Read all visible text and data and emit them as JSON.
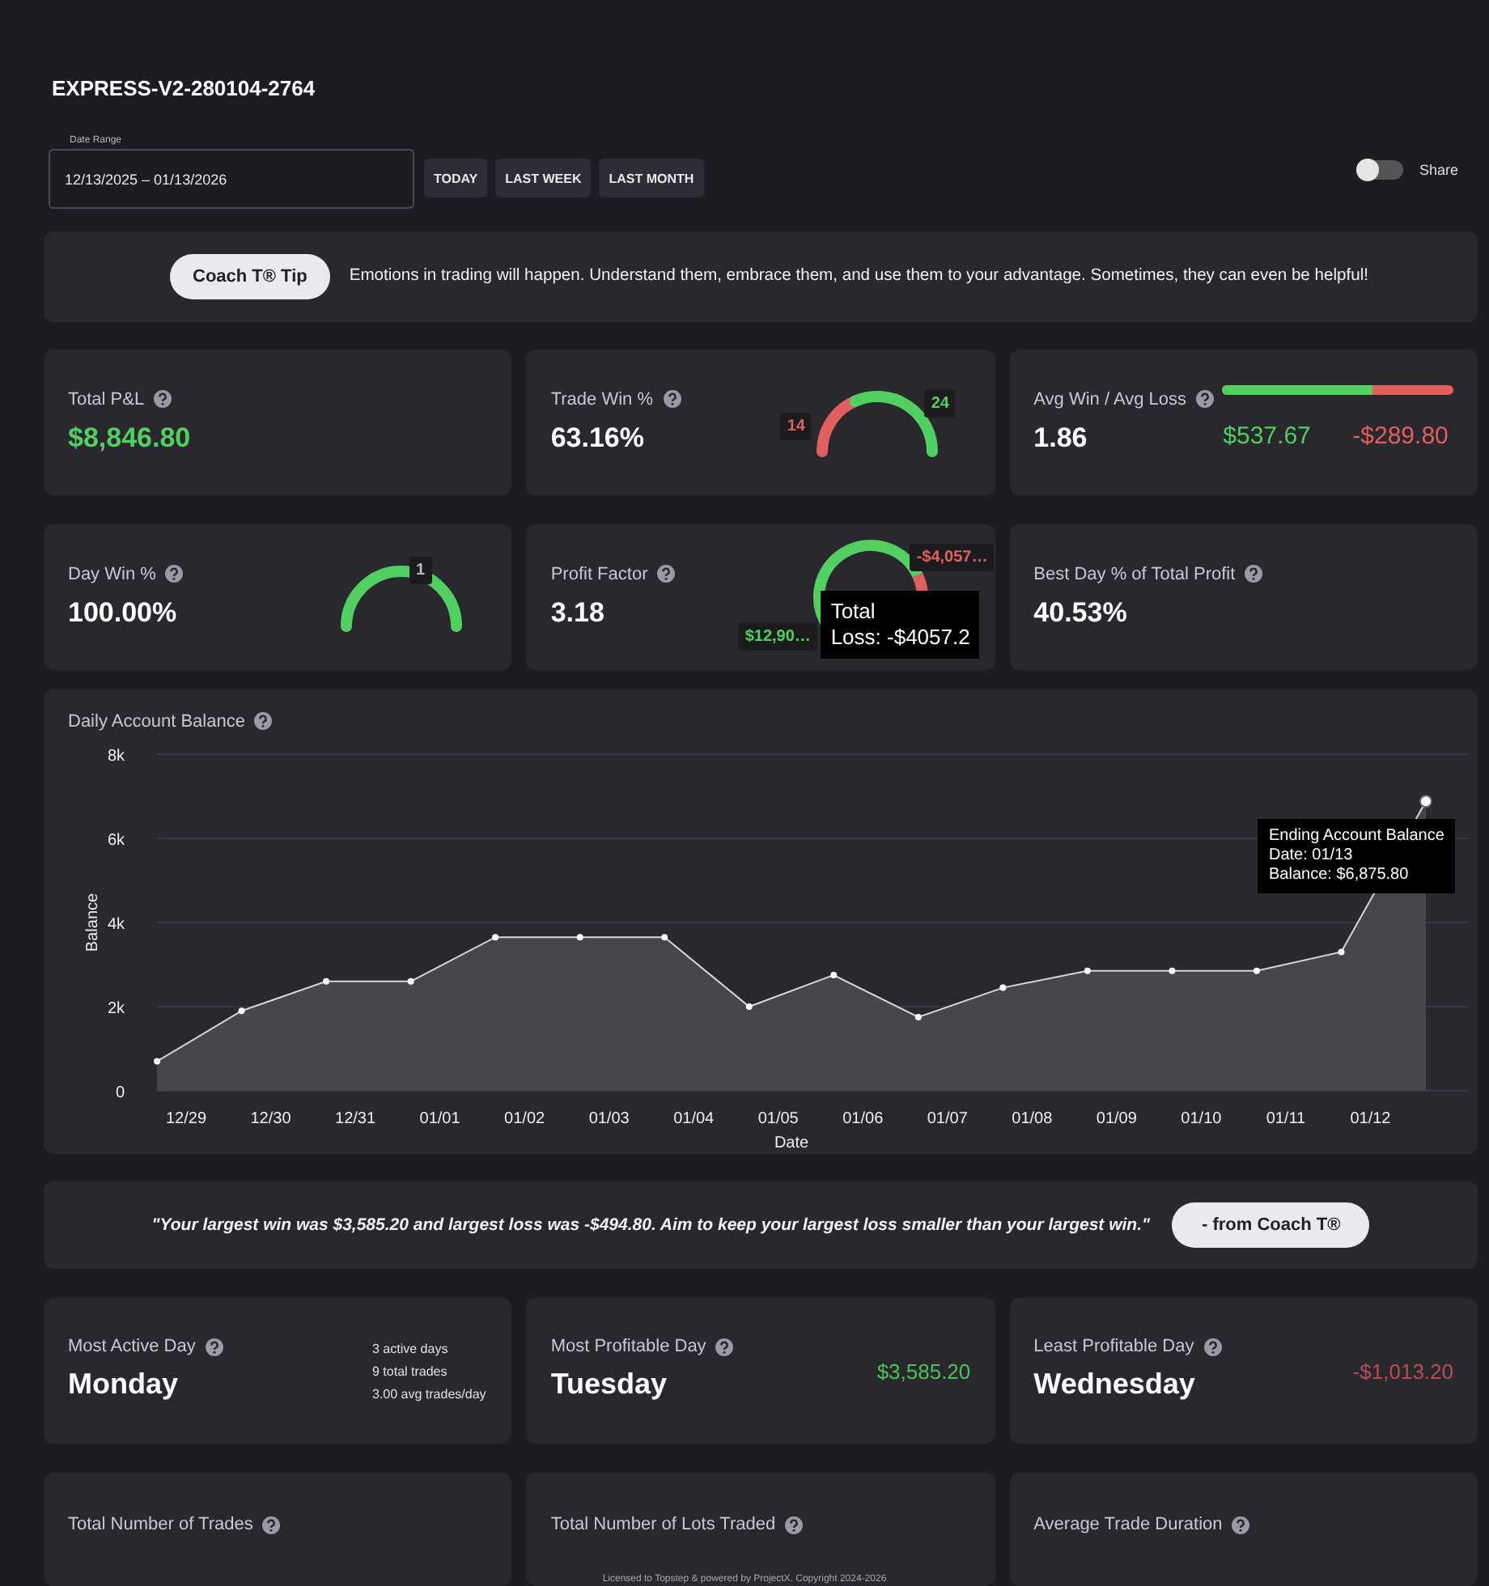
{
  "account": {
    "title": "EXPRESS-V2-280104-2764"
  },
  "date_range": {
    "label": "Date Range",
    "value": "12/13/2025 – 01/13/2026",
    "buttons": [
      "TODAY",
      "LAST WEEK",
      "LAST MONTH"
    ]
  },
  "share": {
    "label": "Share",
    "on": false
  },
  "tip": {
    "button": "Coach T® Tip",
    "text": "Emotions in trading will happen. Understand them, embrace them, and use them to your advantage. Sometimes, they can even be helpful!"
  },
  "stats": [
    {
      "kind": "plain",
      "label": "Total P&L",
      "value": "$8,846.80",
      "color": "#52cf61"
    },
    {
      "kind": "gauge",
      "label": "Trade Win %",
      "value": "63.16%",
      "loss_count": "14",
      "win_count": "24"
    },
    {
      "kind": "bar",
      "label": "Avg Win / Avg Loss",
      "value": "1.86",
      "level": 0.65,
      "avg_win": "$537.67",
      "avg_loss": "-$289.80"
    },
    {
      "kind": "gauge",
      "label": "Day Win %",
      "value": "100.00%",
      "win_count": "1"
    },
    {
      "kind": "donut",
      "label": "Profit Factor",
      "value": "3.18",
      "level": 0.76,
      "gross_profit": "$12,90…",
      "gross_loss": "-$4,057…",
      "tooltip": [
        "Total",
        "Loss: -$4057.2"
      ]
    },
    {
      "kind": "plain",
      "label": "Best Day % of Total Profit",
      "value": "40.53%"
    }
  ],
  "balance": {
    "title": "Daily Account Balance",
    "tooltip": [
      "Ending Account Balance",
      "Date: 01/13",
      "Balance: $6,875.80"
    ],
    "chart_data": {
      "type": "area",
      "xlabel": "Date",
      "ylabel": "Balance",
      "categories": [
        "12/29",
        "12/30",
        "12/31",
        "01/01",
        "01/02",
        "01/03",
        "01/04",
        "01/05",
        "01/06",
        "01/07",
        "01/08",
        "01/09",
        "01/10",
        "01/11",
        "01/12",
        null
      ],
      "series": [
        {
          "color": "#d8d8d8",
          "values": [
            700,
            1900,
            2600,
            2600,
            3650,
            3650,
            3650,
            2000,
            2750,
            1750,
            2450,
            2850,
            2850,
            2850,
            3300,
            6880
          ]
        }
      ],
      "grid": true,
      "ylim": [
        0,
        8000
      ],
      "yticks": [
        {
          "value": 0,
          "label": "0"
        },
        {
          "value": 2000,
          "label": "2k"
        },
        {
          "value": 4000,
          "label": "4k"
        },
        {
          "value": 6000,
          "label": "6k"
        },
        {
          "value": 8000,
          "label": "8k"
        }
      ]
    }
  },
  "quote": {
    "text": "\"Your largest win was $3,585.20 and largest loss was -$494.80. Aim to keep your largest loss smaller than your largest win.\"",
    "button": "- from Coach T®"
  },
  "days": [
    {
      "label": "Most Active Day",
      "day": "Monday",
      "details": [
        "3 active days",
        "9 total trades",
        "3.00 avg trades/day"
      ]
    },
    {
      "label": "Most Profitable Day",
      "day": "Tuesday",
      "amount": "$3,585.20",
      "color": "#4dc25a"
    },
    {
      "label": "Least Profitable Day",
      "day": "Wednesday",
      "amount": "-$1,013.20",
      "color": "#b94b58"
    }
  ],
  "totals": [
    "Total Number of Trades",
    "Total Number of Lots Traded",
    "Average Trade Duration"
  ],
  "footer": "Licensed to Topstep & powered by ProjectX. Copyright 2024-2026"
}
